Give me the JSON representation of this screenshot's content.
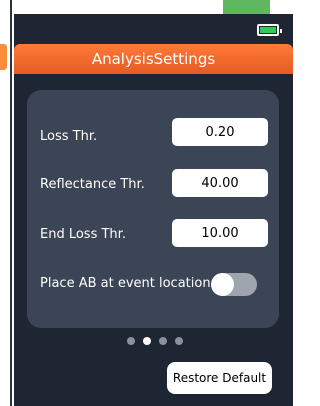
{
  "header": {
    "title": "AnalysisSettings"
  },
  "settings": [
    {
      "label": "Loss Thr.",
      "value": "0.20"
    },
    {
      "label": "Reflectance Thr.",
      "value": "40.00"
    },
    {
      "label": "End Loss Thr.",
      "value": "10.00"
    }
  ],
  "toggle": {
    "label": "Place AB at event location",
    "on": false
  },
  "pager": {
    "active_index": 1,
    "count": 4
  },
  "footer": {
    "restore_label": "Restore Default"
  },
  "colors": {
    "accent": "#e8622a",
    "background": "#1f2633",
    "panel": "#3b4556",
    "battery": "#2dcf4e",
    "top_green": "#5fb760"
  },
  "icons": [
    "battery-icon",
    "toggle-switch-icon"
  ]
}
